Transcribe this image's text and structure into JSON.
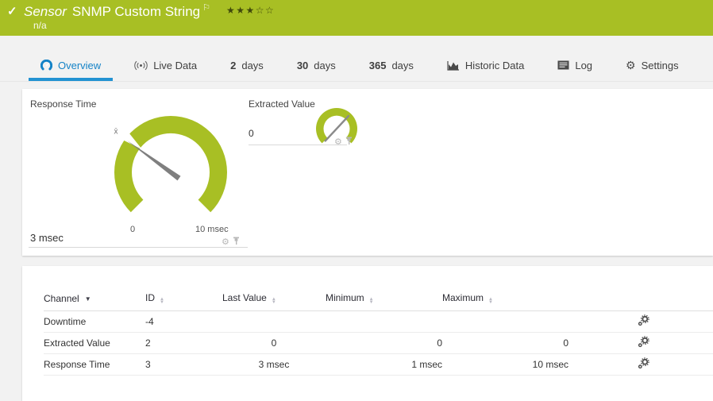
{
  "colors": {
    "green": "#a8bf24",
    "blue": "#1583c7"
  },
  "header": {
    "type_label": "Sensor",
    "title": "SNMP Custom String",
    "subtitle": "n/a",
    "stars_filled": 3,
    "stars_total": 5
  },
  "tabs": [
    {
      "id": "overview",
      "label": "Overview",
      "icon": "gauge-icon",
      "active": true
    },
    {
      "id": "live-data",
      "label": "Live Data",
      "icon": "broadcast-icon"
    },
    {
      "id": "2-days",
      "prefix": "2",
      "label": "days"
    },
    {
      "id": "30-days",
      "prefix": "30",
      "label": "days"
    },
    {
      "id": "365-days",
      "prefix": "365",
      "label": "days"
    },
    {
      "id": "historic-data",
      "label": "Historic Data",
      "icon": "chart-icon"
    },
    {
      "id": "log",
      "label": "Log",
      "icon": "log-icon"
    },
    {
      "id": "settings",
      "label": "Settings",
      "icon": "gear-icon"
    }
  ],
  "overview": {
    "response_time": {
      "title": "Response Time",
      "value": 3,
      "unit": "msec",
      "value_label": "3 msec",
      "min": 0,
      "max": 10,
      "scale_min_label": "0",
      "scale_max_label": "10 msec",
      "avg": 3.1,
      "mean_marker": "x̄"
    },
    "extracted_value": {
      "title": "Extracted Value",
      "value": 0,
      "value_label": "0"
    }
  },
  "chart_data": [
    {
      "type": "gauge",
      "title": "Response Time",
      "value": 3,
      "min": 0,
      "max": 10,
      "unit": "msec",
      "mean": 3.1
    },
    {
      "type": "gauge",
      "title": "Extracted Value",
      "value": 0
    }
  ],
  "table": {
    "columns": [
      {
        "key": "channel",
        "label": "Channel",
        "sort": "desc"
      },
      {
        "key": "id",
        "label": "ID",
        "sort": "both"
      },
      {
        "key": "last",
        "label": "Last Value",
        "sort": "both"
      },
      {
        "key": "min",
        "label": "Minimum",
        "sort": "both"
      },
      {
        "key": "max",
        "label": "Maximum",
        "sort": "both"
      },
      {
        "key": "settings",
        "label": ""
      }
    ],
    "rows": [
      {
        "channel": "Downtime",
        "id": "-4",
        "last": "",
        "min": "",
        "max": ""
      },
      {
        "channel": "Extracted Value",
        "id": "2",
        "last": "0",
        "min": "0",
        "max": "0"
      },
      {
        "channel": "Response Time",
        "id": "3",
        "last": "3 msec",
        "min": "1 msec",
        "max": "10 msec"
      }
    ]
  },
  "icons": {
    "check": "✓",
    "flag": "⚐",
    "star_filled": "★",
    "star_empty": "☆",
    "gear": "⚙",
    "sort_asc": "▲",
    "sort_desc": "▼"
  }
}
